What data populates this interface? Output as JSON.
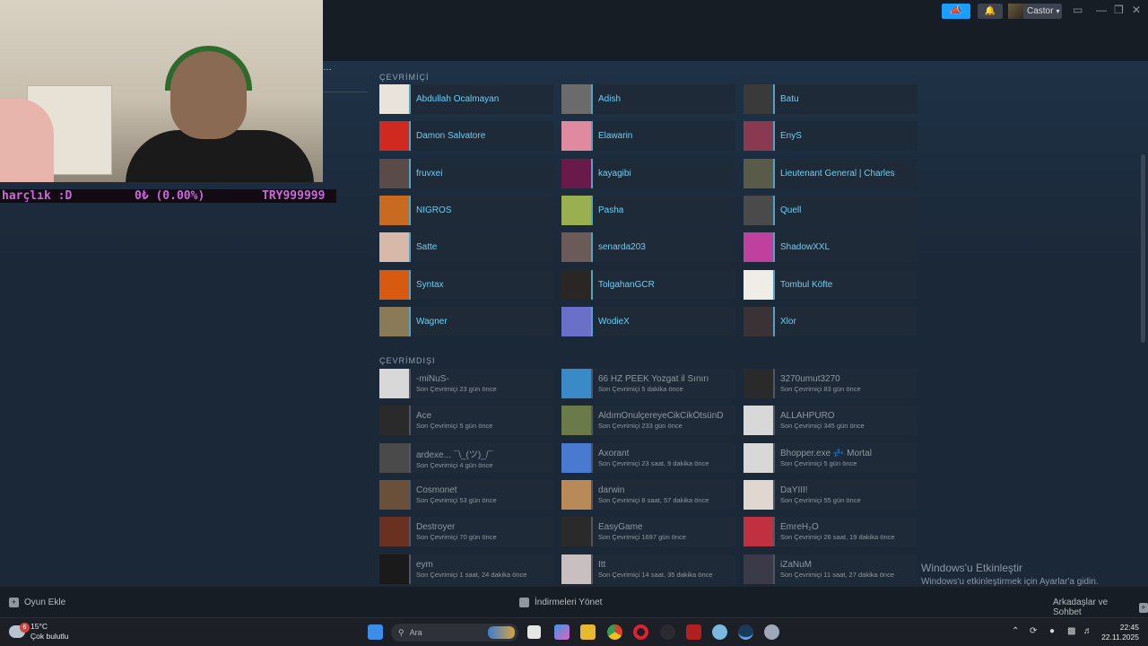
{
  "titlebar": {
    "username": "Castor"
  },
  "ticker": {
    "label": "harçlık :D",
    "value": "0₺ (0.00%)",
    "code": "TRY999999"
  },
  "online": {
    "label": "ÇEVRİMİÇİ",
    "friends": [
      {
        "name": "Abdullah Ocalmayan",
        "color": "#e8e4dc"
      },
      {
        "name": "Adish",
        "color": "#6b6b6b"
      },
      {
        "name": "Batu",
        "color": "#3a3a3a"
      },
      {
        "name": "Damon Salvatore",
        "color": "#d02a20"
      },
      {
        "name": "Elawarin",
        "color": "#e08aa0"
      },
      {
        "name": "EnyS",
        "color": "#8a3a50"
      },
      {
        "name": "fruvxei",
        "color": "#5a4a48"
      },
      {
        "name": "kayagibi",
        "color": "#6a1a4a"
      },
      {
        "name": "Lieutenant General | Charles",
        "color": "#5a5a48"
      },
      {
        "name": "NİGROS",
        "color": "#c86a20"
      },
      {
        "name": "Pasha",
        "color": "#9ab050"
      },
      {
        "name": "Quell",
        "color": "#4a4a4a"
      },
      {
        "name": "Satte",
        "color": "#d8b8a8"
      },
      {
        "name": "senarda203",
        "color": "#6a5a58"
      },
      {
        "name": "ShadowXXL",
        "color": "#c040a0"
      },
      {
        "name": "Syntax",
        "color": "#d85a10"
      },
      {
        "name": "TolgahanGCR",
        "color": "#2a2624"
      },
      {
        "name": "Tombul Köfte",
        "color": "#f0ece6"
      },
      {
        "name": "Wagner",
        "color": "#8a7a58"
      },
      {
        "name": "WodieX",
        "color": "#6a70c8"
      },
      {
        "name": "Xlor",
        "color": "#3a3234"
      }
    ]
  },
  "offline": {
    "label": "ÇEVRİMDIŞI",
    "friends": [
      {
        "name": "-miNuS-",
        "last": "Son Çevrimiçi 23 gün önce",
        "color": "#d8d8d8"
      },
      {
        "name": "66 HZ PEEK Yozgat il Sınırı",
        "last": "Son Çevrimiçi 5 dakika önce",
        "color": "#3a8ac8"
      },
      {
        "name": "3270umut3270",
        "last": "Son Çevrimiçi 83 gün önce",
        "color": "#2a2a2a"
      },
      {
        "name": "Ace",
        "last": "Son Çevrimiçi 5 gün önce",
        "color": "#2a2a2a"
      },
      {
        "name": "AldımOnulçereyeCikCikÖtsünD",
        "last": "Son Çevrimiçi 233 gün önce",
        "color": "#6a7a48"
      },
      {
        "name": "ALLAHPURO",
        "last": "Son Çevrimiçi 345 gün önce",
        "color": "#d8d8d8"
      },
      {
        "name": "ardexe... ¯\\_(ツ)_/¯",
        "last": "Son Çevrimiçi 4 gün önce",
        "color": "#4a4a4a"
      },
      {
        "name": "Axorant",
        "last": "Son Çevrimiçi 23 saat, 9 dakika önce",
        "color": "#4a7ad0"
      },
      {
        "name": "Bhopper.exe 💤 Mortal",
        "last": "Son Çevrimiçi 5 gün önce",
        "color": "#d8d8d8"
      },
      {
        "name": "Cosmonet",
        "last": "Son Çevrimiçi 53 gün önce",
        "color": "#6a5038"
      },
      {
        "name": "darwin",
        "last": "Son Çevrimiçi 8 saat, 57 dakika önce",
        "color": "#b88a58"
      },
      {
        "name": "DaYIII!",
        "last": "Son Çevrimiçi 55 gün önce",
        "color": "#e0d8d0"
      },
      {
        "name": "Destroyer",
        "last": "Son Çevrimiçi 70 gün önce",
        "color": "#6a3020"
      },
      {
        "name": "EasyGame",
        "last": "Son Çevrimiçi 1697 gün önce",
        "color": "#2a2a2a"
      },
      {
        "name": "EmreH₂O",
        "last": "Son Çevrimiçi 26 saat, 19 dakika önce",
        "color": "#c03040"
      },
      {
        "name": "eym",
        "last": "Son Çevrimiçi 1 saat, 24 dakika önce",
        "color": "#1a1a1a"
      },
      {
        "name": "Itt",
        "last": "Son Çevrimiçi 14 saat, 35 dakika önce",
        "color": "#c8c0c0"
      },
      {
        "name": "iZaNuM",
        "last": "Son Çevrimiçi 11 saat, 27 dakika önce",
        "color": "#3a3a48"
      }
    ]
  },
  "watermark": {
    "title": "Windows'u Etkinleştir",
    "subtitle": "Windows'u etkinleştirmek için Ayarlar'a gidin."
  },
  "bottombar": {
    "add_game": "Oyun Ekle",
    "downloads": "İndirmeleri Yönet",
    "friends_chat": "Arkadaşlar ve Sohbet"
  },
  "taskbar": {
    "weather_temp": "15°C",
    "weather_desc": "Çok bulutlu",
    "weather_badge": "6",
    "search_placeholder": "Ara",
    "time": "22:45",
    "date": "22.11.2025"
  }
}
